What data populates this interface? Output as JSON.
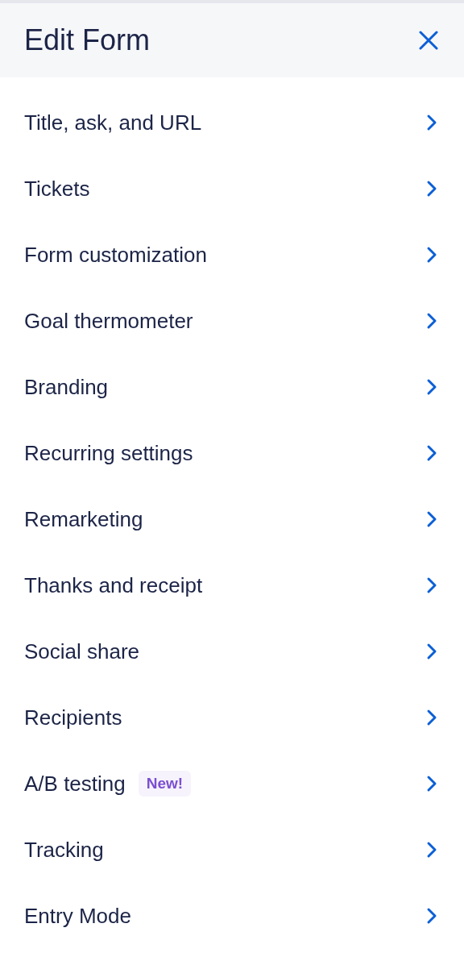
{
  "header": {
    "title": "Edit Form"
  },
  "items": [
    {
      "label": "Title, ask, and URL"
    },
    {
      "label": "Tickets"
    },
    {
      "label": "Form customization"
    },
    {
      "label": "Goal thermometer"
    },
    {
      "label": "Branding"
    },
    {
      "label": "Recurring settings"
    },
    {
      "label": "Remarketing"
    },
    {
      "label": "Thanks and receipt"
    },
    {
      "label": "Social share"
    },
    {
      "label": "Recipients"
    },
    {
      "label": "A/B testing",
      "badge": "New!"
    },
    {
      "label": "Tracking"
    },
    {
      "label": "Entry Mode"
    }
  ]
}
